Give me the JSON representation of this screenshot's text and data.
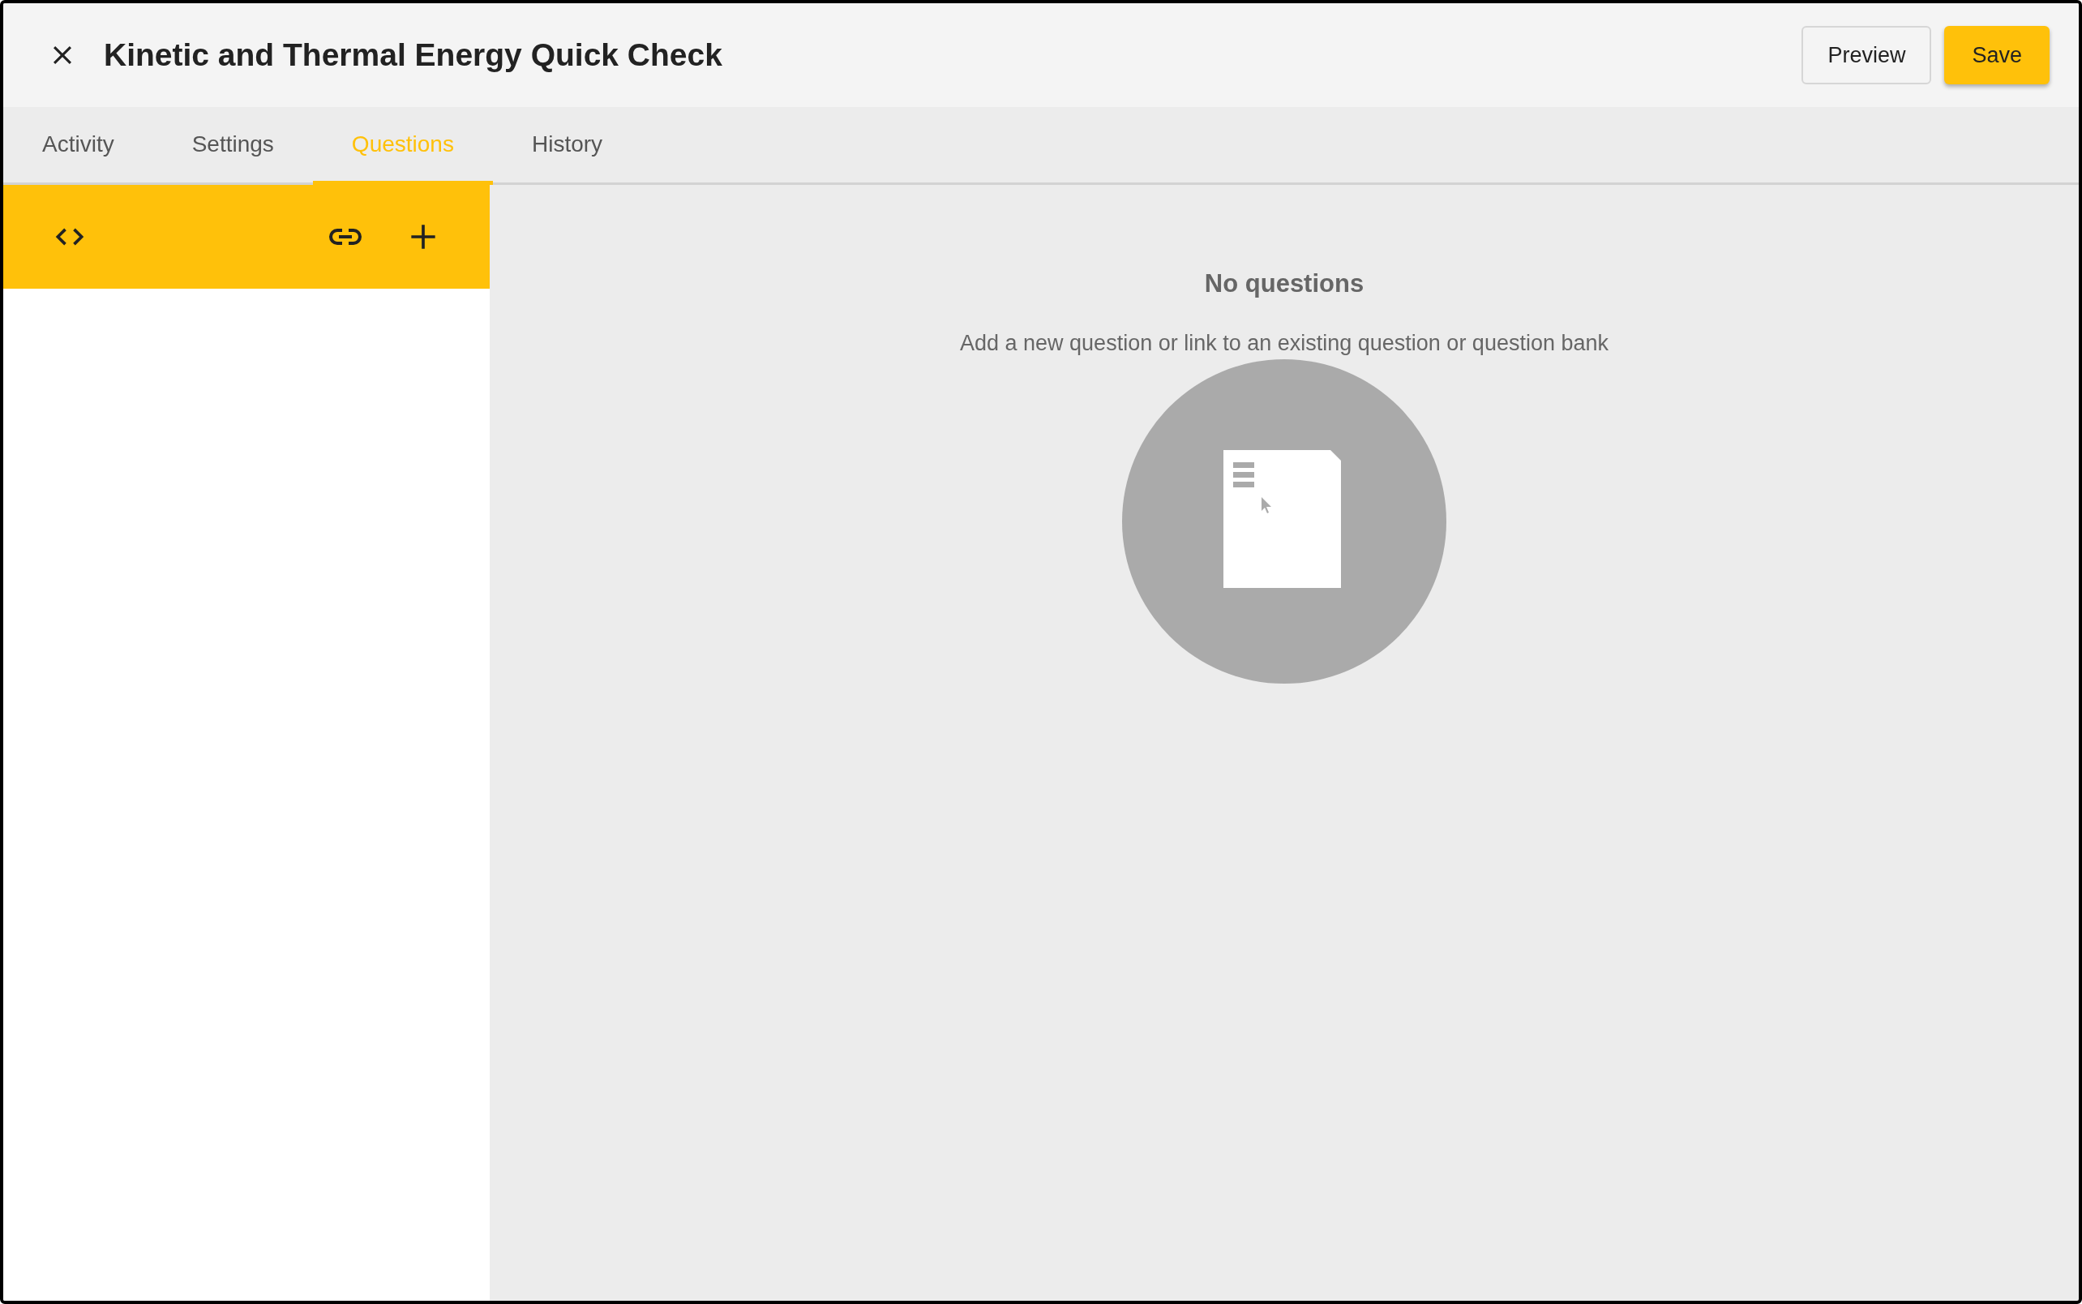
{
  "header": {
    "title": "Kinetic and Thermal Energy Quick Check",
    "buttons": [
      {
        "label": "Preview",
        "kind": "secondary"
      },
      {
        "label": "Save",
        "kind": "primary"
      }
    ]
  },
  "tabs": [
    {
      "label": "Activity",
      "selected": false
    },
    {
      "label": "Settings",
      "selected": false
    },
    {
      "label": "Questions",
      "selected": true
    },
    {
      "label": "History",
      "selected": false
    }
  ],
  "empty_state": {
    "title": "No questions",
    "message": "Add a new question or link to an existing question or question bank"
  }
}
